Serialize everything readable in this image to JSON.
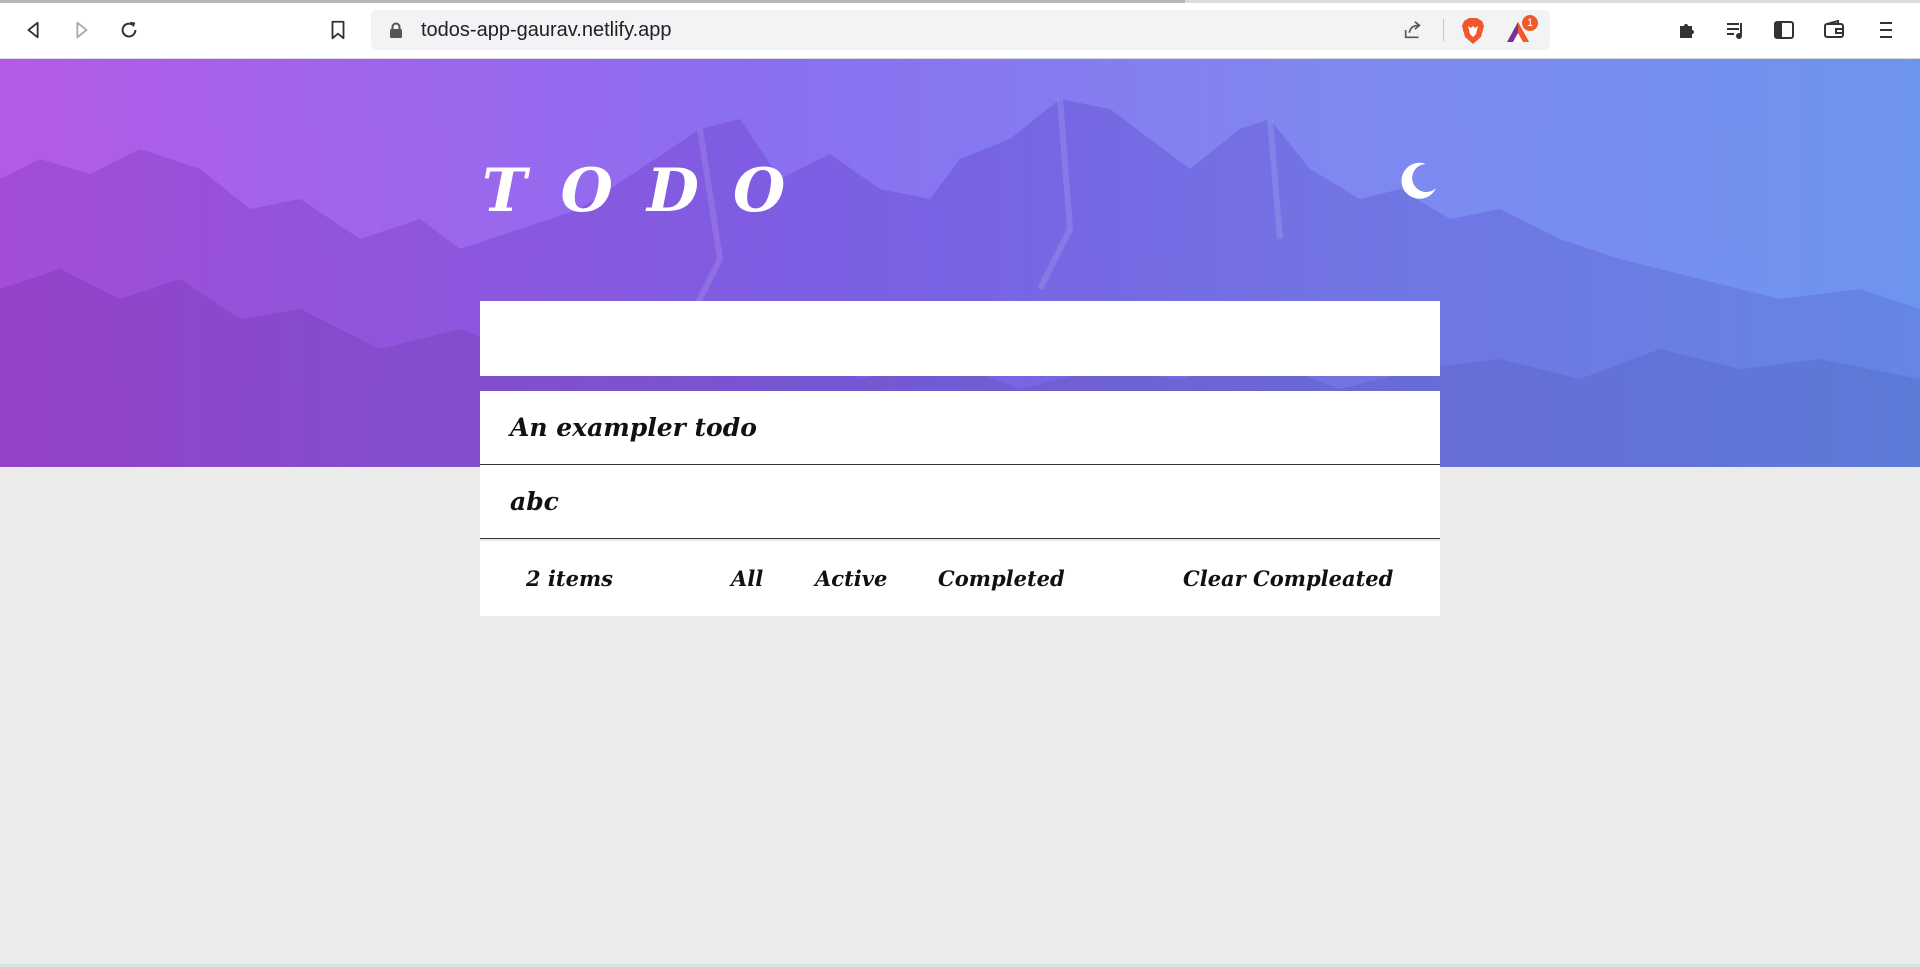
{
  "browser": {
    "url": "todos-app-gaurav.netlify.app",
    "bat_badge": "1"
  },
  "icons": {
    "back": "back-arrow-icon",
    "forward": "forward-arrow-icon",
    "reload": "reload-icon",
    "bookmark": "bookmark-icon",
    "lock": "lock-icon",
    "share": "share-icon",
    "brave": "brave-shield-icon",
    "bat": "brave-rewards-icon",
    "extensions": "puzzle-icon",
    "playlist": "playlist-icon",
    "sidebar": "sidebar-icon",
    "wallet": "wallet-icon",
    "menu": "menu-icon",
    "theme": "moon-icon"
  },
  "app": {
    "title": "TODO",
    "new_todo_value": "",
    "todos": [
      {
        "text": "An exampler todo"
      },
      {
        "text": "abc"
      }
    ],
    "footer": {
      "count": "2 items",
      "filters": [
        "All",
        "Active",
        "Completed"
      ],
      "clear": "Clear Compleated"
    }
  },
  "colors": {
    "gradient_start": "#b35be8",
    "gradient_end": "#6d95ef",
    "page_background": "#ebebeb",
    "card": "#ffffff"
  }
}
